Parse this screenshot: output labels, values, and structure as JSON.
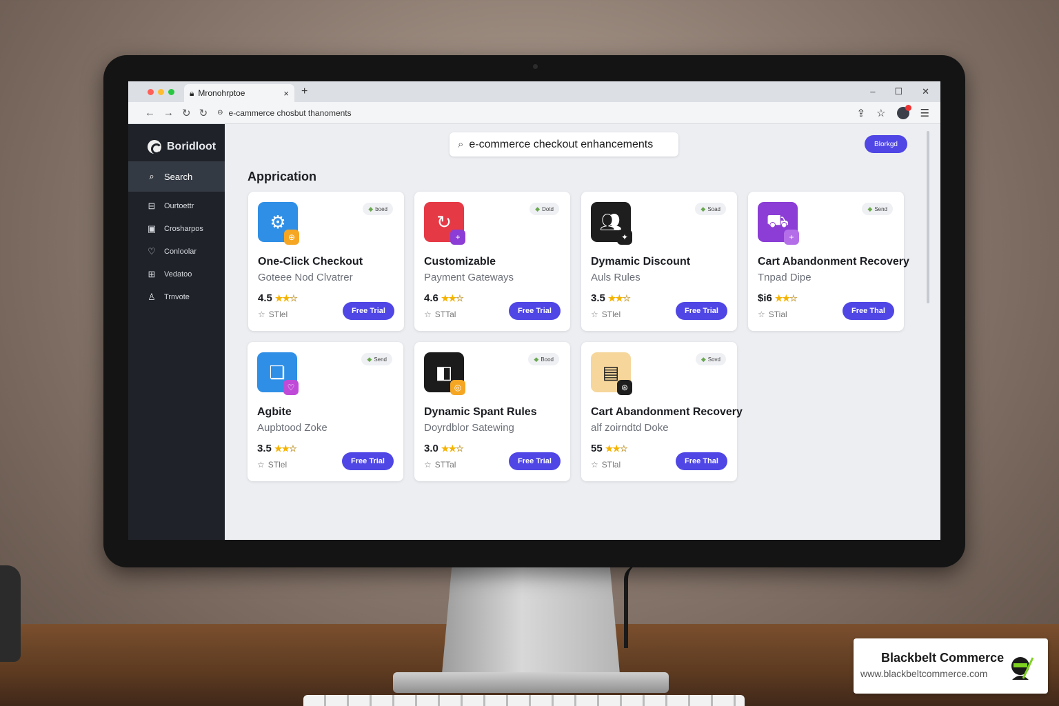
{
  "browser": {
    "tab_title": "Mronohrptoe",
    "tab_close": "×",
    "new_tab": "+",
    "window_controls": [
      "–",
      "☐",
      "✕"
    ],
    "url": "e-cammerce chosbut thanoments",
    "nav_icons": [
      "←",
      "→",
      "↻",
      "↻"
    ]
  },
  "app": {
    "brand": "Boridloot",
    "sidebar": [
      {
        "label": "Search",
        "icon": "search-icon",
        "active": true
      },
      {
        "label": "Ourtoettr",
        "icon": "inbox-icon"
      },
      {
        "label": "Crosharpos",
        "icon": "board-icon"
      },
      {
        "label": "Conloolar",
        "icon": "heart-icon"
      },
      {
        "label": "Vedatoo",
        "icon": "grid-icon"
      },
      {
        "label": "Trnvote",
        "icon": "user-icon"
      }
    ],
    "search_query": "e-commerce checkout enhancements",
    "top_button": "Blorkgd",
    "section_title": "Apprication"
  },
  "cards": [
    {
      "title": "One-Click Checkout",
      "subtitle": "Goteee Nod Clvatrer",
      "rating": "4.5",
      "trial": "STlel",
      "tag": "boed",
      "button": "Free Trial",
      "icon_color": "#2f8fe6",
      "sub_color": "#f5a623",
      "icon": "gear-icon"
    },
    {
      "title": "Customizable",
      "subtitle": "Payment Gateways",
      "rating": "4.6",
      "trial": "STTal",
      "tag": "Dotd",
      "button": "Free Trial",
      "icon_color": "#e63946",
      "sub_color": "#8b3dd6",
      "icon": "refresh-icon"
    },
    {
      "title": "Dymamic Discount",
      "subtitle": "Auls Rules",
      "rating": "3.5",
      "trial": "STlel",
      "tag": "Soad",
      "button": "Free Trial",
      "icon_color": "#1e1e1e",
      "sub_color": "#1e1e1e",
      "icon": "people-icon"
    },
    {
      "title": "Cart Abandonment Recovery",
      "subtitle": "Tnpad Dipe",
      "rating": "$i6",
      "trial": "STial",
      "tag": "Send",
      "button": "Free Thal",
      "icon_color": "#8b3dd6",
      "sub_color": "#b46ee8",
      "icon": "cart-icon"
    },
    {
      "title": "Agbite",
      "subtitle": "Aupbtood Zoke",
      "rating": "3.5",
      "trial": "STlel",
      "tag": "Send",
      "button": "Free Trial",
      "icon_color": "#2f8fe6",
      "sub_color": "#c04ad8",
      "icon": "chat-icon"
    },
    {
      "title": "Dynamic Spant Rules",
      "subtitle": "Doyrdblor Satewing",
      "rating": "3.0",
      "trial": "STTal",
      "tag": "Bood",
      "button": "Free Trial",
      "icon_color": "#1b1b1b",
      "sub_color": "#f5a623",
      "icon": "shapes-icon"
    },
    {
      "title": "Cart Abandonment Recovery",
      "subtitle": "alf zoirndtd Doke",
      "rating": "55",
      "trial": "STlal",
      "tag": "Sovd",
      "button": "Free Thal",
      "icon_color": "#f6d69a",
      "sub_color": "#1e1e1e",
      "icon": "receipt-icon"
    }
  ],
  "watermark": {
    "name": "Blackbelt Commerce",
    "url": "www.blackbeltcommerce.com"
  }
}
